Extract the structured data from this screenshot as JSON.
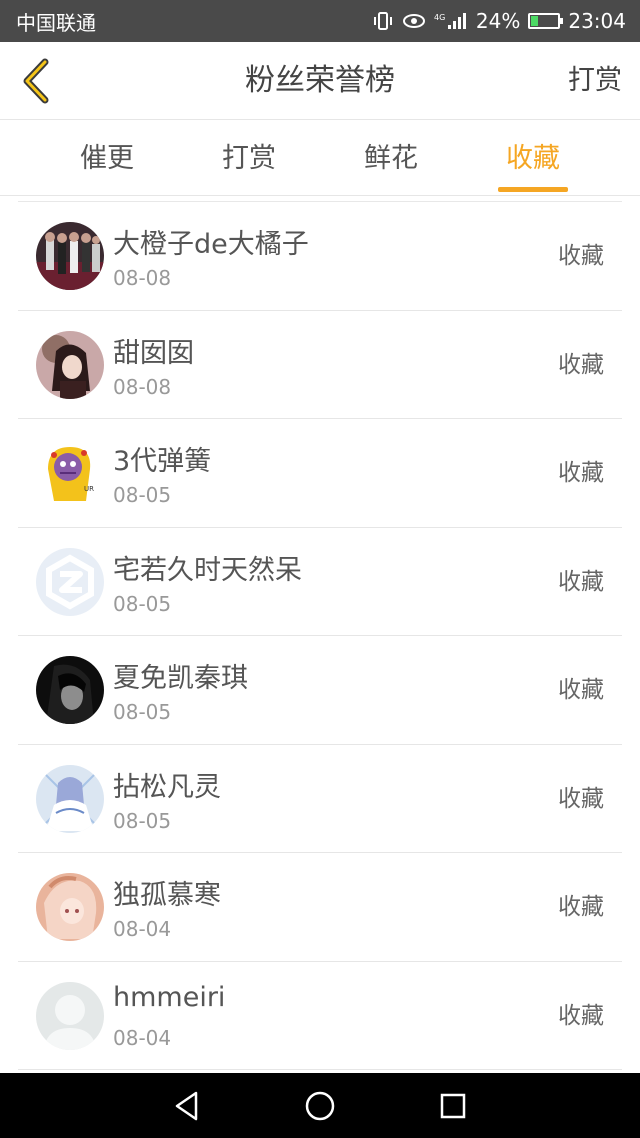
{
  "status_bar": {
    "carrier": "中国联通",
    "network": "4G",
    "battery": "24%",
    "time": "23:04"
  },
  "header": {
    "title": "粉丝荣誉榜",
    "right_action": "打赏",
    "accent_color": "#f5a623"
  },
  "tabs": [
    {
      "label": "催更",
      "active": false
    },
    {
      "label": "打赏",
      "active": false
    },
    {
      "label": "鲜花",
      "active": false
    },
    {
      "label": "收藏",
      "active": true
    }
  ],
  "fans": [
    {
      "name": "大橙子de大橘子",
      "date": "08-08",
      "action": "收藏",
      "avatar": "group-photo"
    },
    {
      "name": "甜囡囡",
      "date": "08-08",
      "action": "收藏",
      "avatar": "girl-portrait"
    },
    {
      "name": "3代弹簧",
      "date": "08-05",
      "action": "收藏",
      "avatar": "cartoon-character"
    },
    {
      "name": "宅若久时天然呆",
      "date": "08-05",
      "action": "收藏",
      "avatar": "default-z-logo"
    },
    {
      "name": "夏免凯秦琪",
      "date": "08-05",
      "action": "收藏",
      "avatar": "dark-portrait"
    },
    {
      "name": "拈松凡灵",
      "date": "08-05",
      "action": "收藏",
      "avatar": "anime-blue"
    },
    {
      "name": "独孤慕寒",
      "date": "08-04",
      "action": "收藏",
      "avatar": "anime-pink"
    },
    {
      "name": "hmmeiri",
      "date": "08-04",
      "action": "收藏",
      "avatar": "default-person"
    }
  ]
}
